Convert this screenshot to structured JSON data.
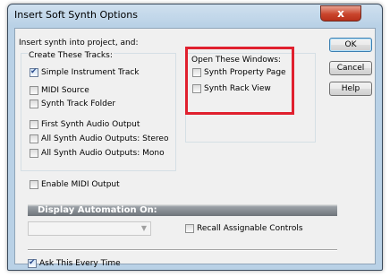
{
  "window": {
    "title": "Insert Soft Synth Options",
    "close_glyph": "x"
  },
  "intro_label": "Insert synth into project, and:",
  "create_tracks": {
    "header": "Create These Tracks:",
    "options": [
      {
        "label": "Simple Instrument Track",
        "checked": true
      },
      {
        "label": "MIDI Source",
        "checked": false
      },
      {
        "label": "Synth Track Folder",
        "checked": false
      },
      {
        "label": "First Synth Audio Output",
        "checked": false
      },
      {
        "label": "All Synth Audio Outputs: Stereo",
        "checked": false
      },
      {
        "label": "All Synth Audio Outputs: Mono",
        "checked": false
      }
    ],
    "enable_midi_output": {
      "label": "Enable MIDI Output",
      "checked": false
    }
  },
  "open_windows": {
    "header": "Open These Windows:",
    "options": [
      {
        "label": "Synth Property Page",
        "checked": false
      },
      {
        "label": "Synth Rack View",
        "checked": false
      }
    ],
    "highlight_color": "#e0202e"
  },
  "buttons": {
    "ok": "OK",
    "cancel": "Cancel",
    "help": "Help"
  },
  "display_automation": {
    "header": "Display Automation On:",
    "combo_value": "",
    "recall_assignable_controls": {
      "label": "Recall Assignable Controls",
      "checked": false
    }
  },
  "ask_every_time": {
    "label": "Ask This Every Time",
    "checked": true
  }
}
